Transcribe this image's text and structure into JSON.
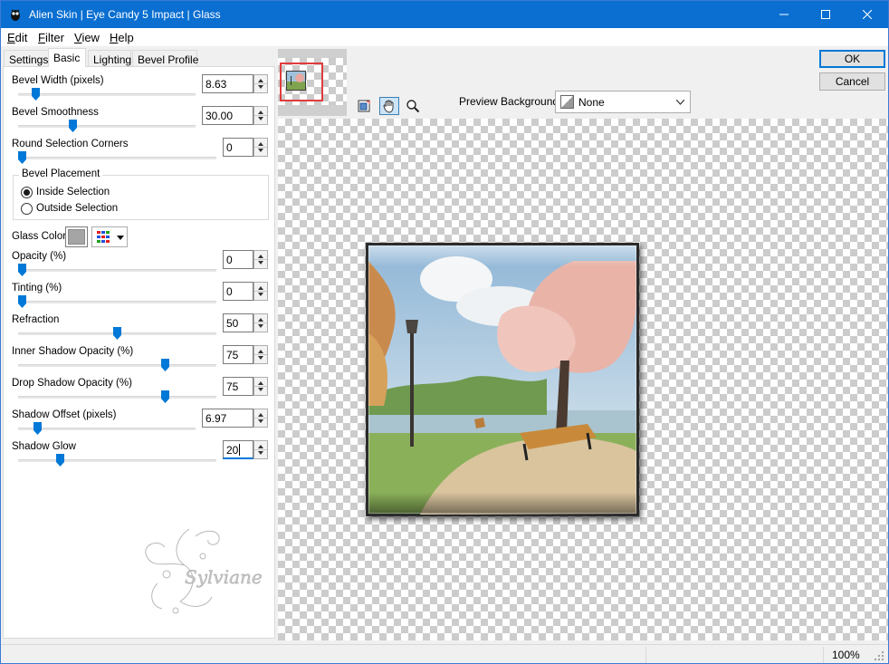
{
  "window": {
    "title": "Alien Skin | Eye Candy 5 Impact | Glass",
    "accent_color": "#0a6fd1"
  },
  "menu": [
    {
      "label": "Edit",
      "ul": "E",
      "rest": "dit"
    },
    {
      "label": "Filter",
      "ul": "F",
      "rest": "ilter"
    },
    {
      "label": "View",
      "ul": "V",
      "rest": "iew"
    },
    {
      "label": "Help",
      "ul": "H",
      "rest": "elp"
    }
  ],
  "tabs": [
    "Settings",
    "Basic",
    "Lighting",
    "Bevel Profile"
  ],
  "active_tab": "Basic",
  "controls": {
    "bevel_width": {
      "label": "Bevel Width (pixels)",
      "value": "8.63",
      "slider_fraction": 0.08
    },
    "bevel_smoothness": {
      "label": "Bevel Smoothness",
      "value": "30.00",
      "slider_fraction": 0.3
    },
    "round_corners": {
      "label": "Round Selection Corners",
      "value": "0",
      "slider_fraction": 0.0
    },
    "bevel_placement": {
      "legend": "Bevel Placement",
      "options": [
        "Inside Selection",
        "Outside Selection"
      ],
      "selected": "Inside Selection"
    },
    "glass_color": {
      "label": "Glass Color",
      "color": "#a5a5a5"
    },
    "opacity": {
      "label": "Opacity (%)",
      "value": "0",
      "slider_fraction": 0.0
    },
    "tinting": {
      "label": "Tinting (%)",
      "value": "0",
      "slider_fraction": 0.0
    },
    "refraction": {
      "label": "Refraction",
      "value": "50",
      "slider_fraction": 0.5
    },
    "inner_shadow_opacity": {
      "label": "Inner Shadow Opacity (%)",
      "value": "75",
      "slider_fraction": 0.75
    },
    "drop_shadow_opacity": {
      "label": "Drop Shadow Opacity (%)",
      "value": "75",
      "slider_fraction": 0.75
    },
    "shadow_offset": {
      "label": "Shadow Offset (pixels)",
      "value": "6.97",
      "slider_fraction": 0.09
    },
    "shadow_glow": {
      "label": "Shadow Glow",
      "value": "20",
      "slider_fraction": 0.2
    }
  },
  "buttons": {
    "ok": "OK",
    "cancel": "Cancel"
  },
  "preview_background": {
    "label": "Preview Background:",
    "value": "None"
  },
  "tools": [
    "navigator-icon",
    "hand-icon",
    "zoom-icon"
  ],
  "watermark_signature": "Sylviane",
  "status": {
    "zoom": "100%"
  }
}
